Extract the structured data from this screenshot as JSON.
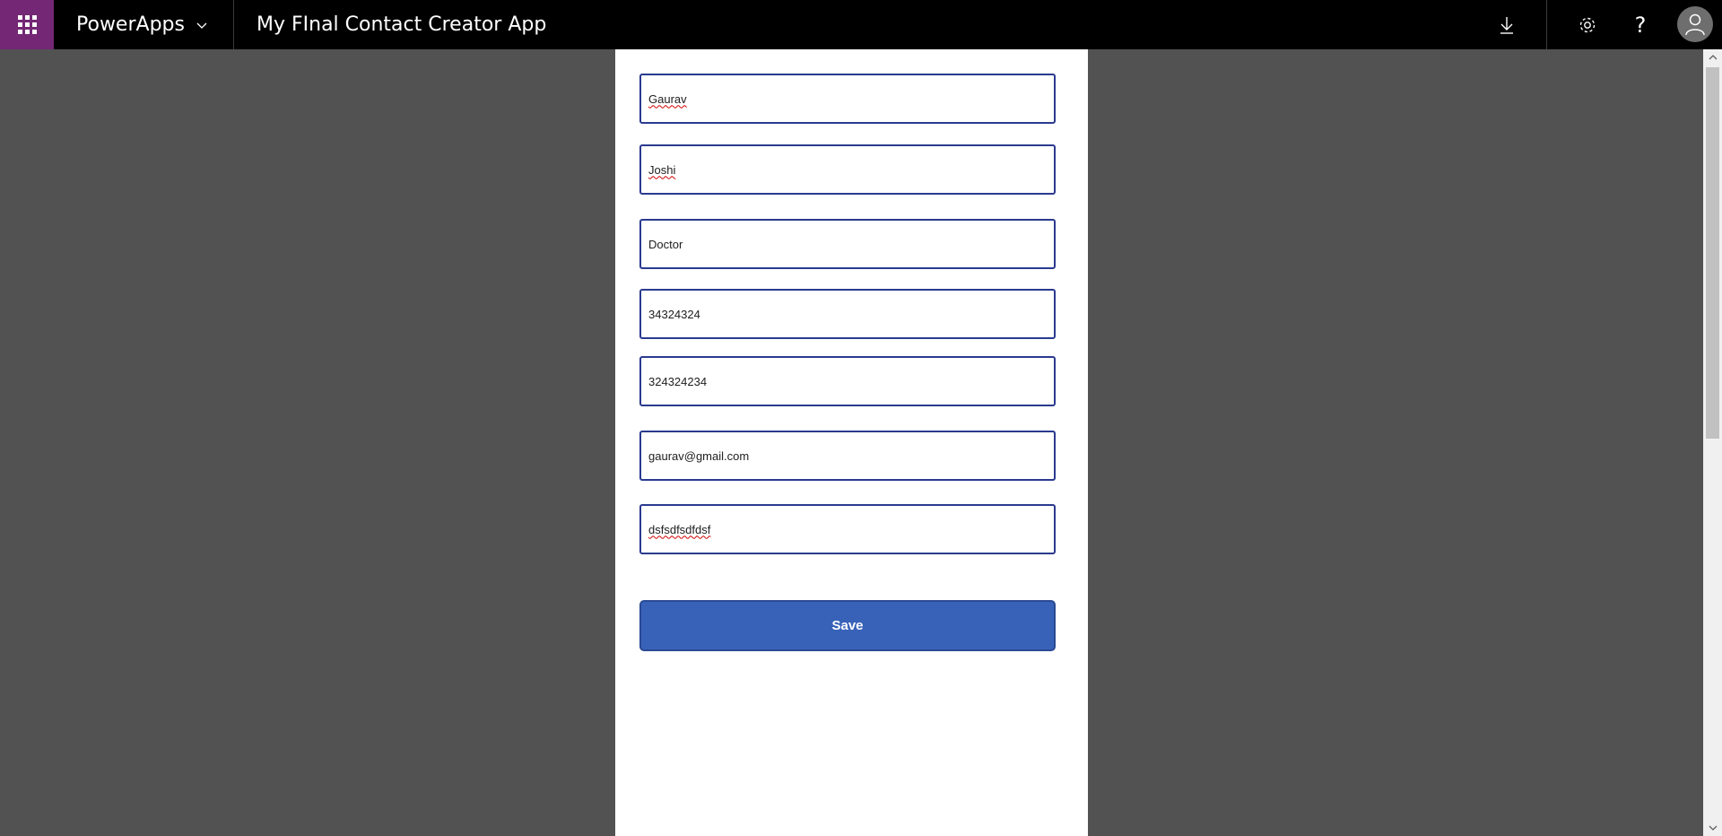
{
  "header": {
    "brand": "PowerApps",
    "app_title": "My FInal Contact Creator App",
    "help_glyph": "?",
    "icons": [
      "app-launcher-icon",
      "chevron-down-icon",
      "download-icon",
      "settings-icon",
      "help-icon",
      "user-avatar-icon"
    ],
    "brand_color": "#742774"
  },
  "form": {
    "fields": [
      {
        "value": "Gaurav"
      },
      {
        "value": "Joshi"
      },
      {
        "value": "Doctor"
      },
      {
        "value": "34324324"
      },
      {
        "value": "324324234"
      },
      {
        "value": "gaurav@gmail.com"
      },
      {
        "value": "dsfsdfsdfdsf"
      }
    ],
    "save_label": "Save",
    "accent_color": "#3862b8"
  },
  "scrollbar": {
    "icons": [
      "scroll-up-icon",
      "scroll-down-icon"
    ]
  }
}
